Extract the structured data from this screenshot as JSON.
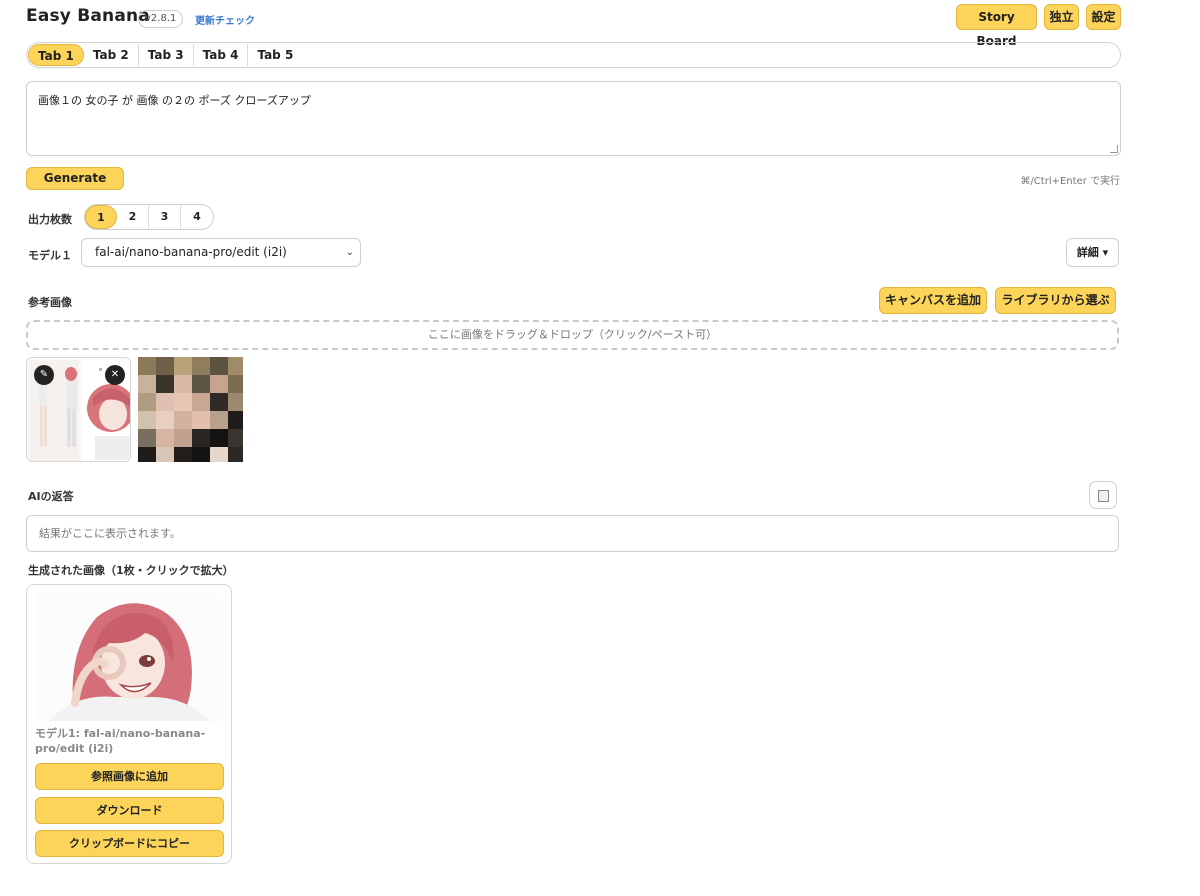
{
  "header": {
    "title": "Easy Banana",
    "version": "v2.8.1",
    "update_link": "更新チェック",
    "story_board": "Story Board",
    "standalone": "独立",
    "settings": "設定"
  },
  "tabs": [
    {
      "label": "Tab 1",
      "active": true
    },
    {
      "label": "Tab 2",
      "active": false
    },
    {
      "label": "Tab 3",
      "active": false
    },
    {
      "label": "Tab 4",
      "active": false
    },
    {
      "label": "Tab 5",
      "active": false
    }
  ],
  "prompt": {
    "value": "画像１の 女の子 が 画像 の２の ポーズ クローズアップ"
  },
  "generate": {
    "label": "Generate",
    "hint": "⌘/Ctrl+Enter で実行"
  },
  "output_count": {
    "label": "出力枚数",
    "options": [
      "1",
      "2",
      "3",
      "4"
    ],
    "selected": "1"
  },
  "model": {
    "label": "モデル１",
    "value": "fal-ai/nano-banana-pro/edit (i2i)",
    "detail_label": "詳細 ▾"
  },
  "reference": {
    "label": "参考画像",
    "add_canvas": "キャンバスを追加",
    "choose_library": "ライブラリから選ぶ",
    "dropzone": "ここに画像をドラッグ＆ドロップ（クリック/ペースト可）"
  },
  "ai_response": {
    "label": "AIの返答",
    "placeholder": "結果がここに表示されます。"
  },
  "generated": {
    "label": "生成された画像（1枚・クリックで拡大）",
    "caption": "モデル1: fal-ai/nano-banana-pro/edit (i2i)",
    "add_to_reference": "参照画像に追加",
    "download": "ダウンロード",
    "copy_clipboard": "クリップボードにコピー"
  },
  "colors": {
    "accent": "#fcd45a",
    "accent_border": "#e3b53a",
    "link": "#3b7bd1"
  }
}
